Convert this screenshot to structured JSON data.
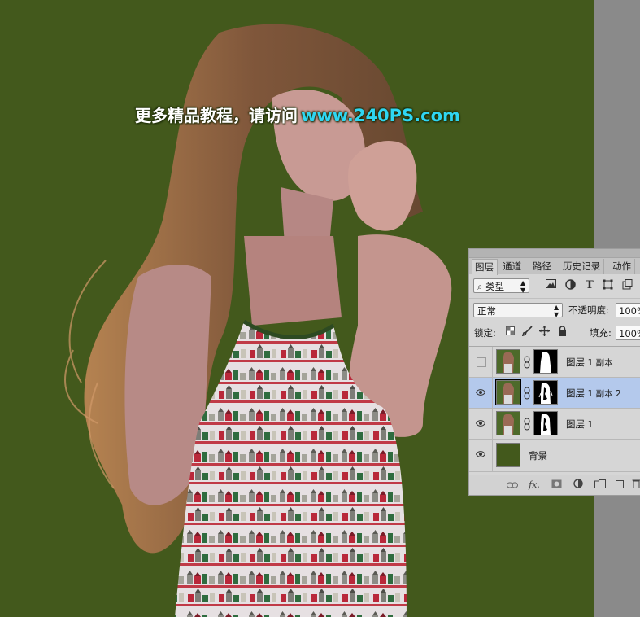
{
  "watermark": {
    "text": "更多精品教程，请访问",
    "url": "www.240PS.com"
  },
  "layers_panel": {
    "tabs": [
      "图层",
      "通道",
      "路径",
      "历史记录",
      "动作"
    ],
    "active_tab": "图层",
    "filter": {
      "kind_label": "类型",
      "search_glyph": "⌕"
    },
    "blend_mode": "正常",
    "opacity_label": "不透明度:",
    "opacity_value": "100%",
    "lock_label": "锁定:",
    "fill_label": "填充:",
    "fill_value": "100%",
    "layers": [
      {
        "name": "图层",
        "num": "1 副本",
        "visible": false,
        "selected": false
      },
      {
        "name": "图层",
        "num": "1 副本 2",
        "visible": true,
        "selected": true
      },
      {
        "name": "图层",
        "num": "1",
        "visible": true,
        "selected": false
      },
      {
        "name": "背景",
        "num": "",
        "visible": true,
        "selected": false
      }
    ],
    "bottom_icons": [
      "link-icon",
      "fx-icon",
      "add-mask-icon",
      "adjustment-icon",
      "group-folder-icon",
      "new-layer-icon",
      "trash-icon"
    ],
    "fx_text": "fx."
  },
  "colors": {
    "canvas_background": "#43591c",
    "selected_layer": "#b4c9ec",
    "watermark_url": "#2fd6f2"
  }
}
